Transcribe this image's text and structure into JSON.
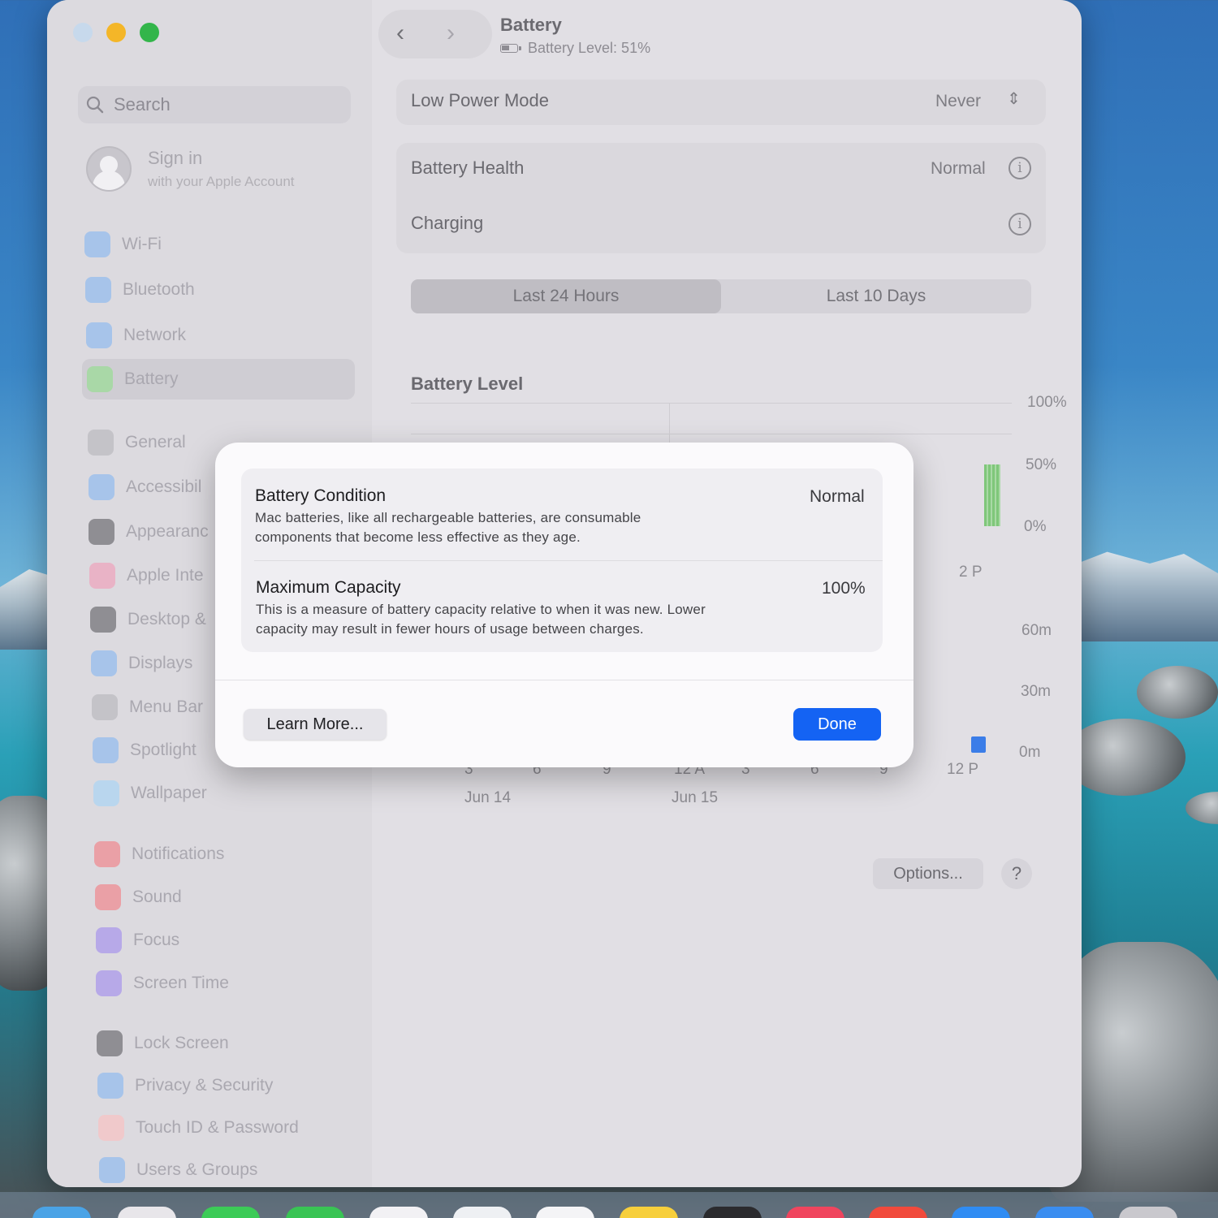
{
  "window": {
    "title": "Battery",
    "subtitle": "Battery Level: 51%"
  },
  "sidebar": {
    "search_placeholder": "Search",
    "account": {
      "title": "Sign in",
      "subtitle": "with your Apple Account"
    },
    "items": [
      {
        "label": "Wi-Fi",
        "icon": "wifi-icon",
        "color": "#a7c4ea"
      },
      {
        "label": "Bluetooth",
        "icon": "bluetooth-icon",
        "color": "#a7c4ea"
      },
      {
        "label": "Network",
        "icon": "network-icon",
        "color": "#a7c4ea"
      },
      {
        "label": "Battery",
        "icon": "battery-icon",
        "color": "#a9d8a7",
        "selected": true
      },
      {
        "label": "General",
        "icon": "gear-icon",
        "color": "#c4c3c8"
      },
      {
        "label": "Accessibil",
        "icon": "accessibility-icon",
        "color": "#a7c4ea"
      },
      {
        "label": "Appearanc",
        "icon": "appearance-icon",
        "color": "#8f8e93"
      },
      {
        "label": "Apple Inte",
        "icon": "apple-intelligence-icon",
        "color": "#e9b3c6"
      },
      {
        "label": "Desktop &",
        "icon": "desktop-icon",
        "color": "#8f8e93"
      },
      {
        "label": "Displays",
        "icon": "displays-icon",
        "color": "#a7c4ea"
      },
      {
        "label": "Menu Bar",
        "icon": "menu-bar-icon",
        "color": "#c4c3c8"
      },
      {
        "label": "Spotlight",
        "icon": "spotlight-icon",
        "color": "#a7c4ea"
      },
      {
        "label": "Wallpaper",
        "icon": "wallpaper-icon",
        "color": "#b9d6ee"
      },
      {
        "label": "Notifications",
        "icon": "notifications-icon",
        "color": "#eaa0a6"
      },
      {
        "label": "Sound",
        "icon": "sound-icon",
        "color": "#eaa0a6"
      },
      {
        "label": "Focus",
        "icon": "focus-icon",
        "color": "#b7a9e8"
      },
      {
        "label": "Screen Time",
        "icon": "screen-time-icon",
        "color": "#b7a9e8"
      },
      {
        "label": "Lock Screen",
        "icon": "lock-icon",
        "color": "#8f8e93"
      },
      {
        "label": "Privacy & Security",
        "icon": "privacy-hand-icon",
        "color": "#a7c4ea"
      },
      {
        "label": "Touch ID & Password",
        "icon": "fingerprint-icon",
        "color": "#f0c9cb"
      },
      {
        "label": "Users & Groups",
        "icon": "users-icon",
        "color": "#a7c4ea"
      }
    ]
  },
  "settings": {
    "low_power": {
      "label": "Low Power Mode",
      "value": "Never"
    },
    "health": {
      "label": "Battery Health",
      "value": "Normal"
    },
    "charging": {
      "label": "Charging"
    }
  },
  "tabs": [
    "Last 24 Hours",
    "Last 10 Days"
  ],
  "chart": {
    "section_title": "Battery Level",
    "level_axis": [
      "100%",
      "50%",
      "0%"
    ],
    "usage_axis": [
      "60m",
      "30m",
      "0m"
    ],
    "partial_tick": "2 P",
    "x_ticks": [
      "3",
      "6",
      "9",
      "12 A",
      "3",
      "6",
      "9",
      "12 P"
    ],
    "dates": [
      "Jun 14",
      "Jun 15"
    ]
  },
  "chart_data": {
    "type": "bar",
    "series": [
      {
        "name": "Battery Level",
        "values": [
          50
        ],
        "color": "#7fc77a"
      },
      {
        "name": "Screen On Usage",
        "values": [
          8
        ],
        "color": "#3b7de8"
      }
    ]
  },
  "buttons": {
    "options": "Options...",
    "help": "?"
  },
  "dialog": {
    "condition": {
      "title": "Battery Condition",
      "value": "Normal",
      "desc_line1": "Mac batteries, like all rechargeable batteries, are consumable",
      "desc_line2": "components that become less effective as they age."
    },
    "capacity": {
      "title": "Maximum Capacity",
      "value": "100%",
      "desc_line1": "This is a measure of battery capacity relative to when it was new. Lower",
      "desc_line2": "capacity may result in fewer hours of usage between charges."
    },
    "learn_more": "Learn More...",
    "done": "Done"
  }
}
